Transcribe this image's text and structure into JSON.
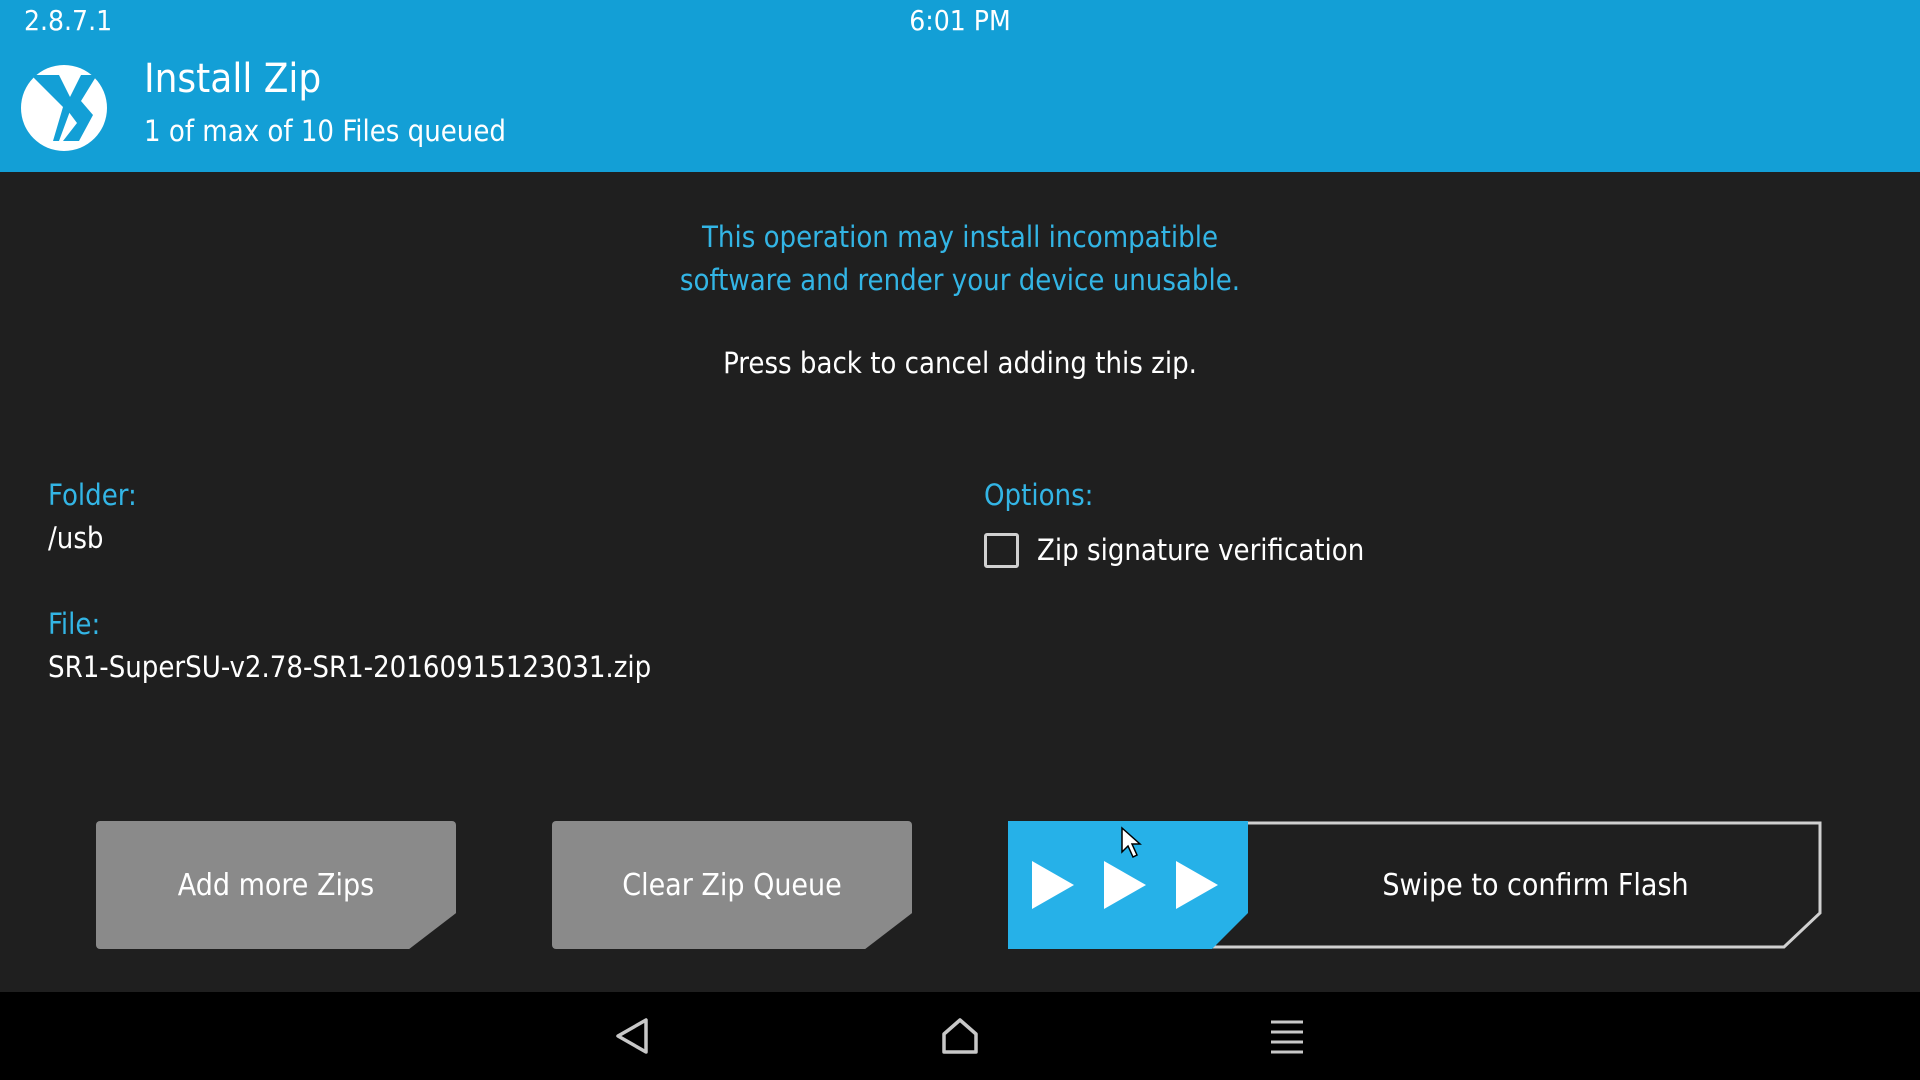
{
  "status": {
    "version": "2.8.7.1",
    "time": "6:01 PM"
  },
  "header": {
    "title": "Install Zip",
    "subtitle": "1 of max of 10 Files queued",
    "logo_icon": "twrp-logo-icon"
  },
  "warning": {
    "line1": "This operation may install incompatible",
    "line2": "software and render your device unusable."
  },
  "instruction": "Press back to cancel adding this zip.",
  "folder": {
    "label": "Folder:",
    "value": "/usb"
  },
  "file": {
    "label": "File:",
    "value": "SR1-SuperSU-v2.78-SR1-20160915123031.zip"
  },
  "options": {
    "label": "Options:",
    "zip_signature_verification": {
      "label": "Zip signature verification",
      "checked": false
    }
  },
  "buttons": {
    "add_more": "Add more Zips",
    "clear_queue": "Clear Zip Queue"
  },
  "slider": {
    "label": "Swipe to confirm Flash",
    "handle_icon": "triple-play-arrows-icon"
  },
  "nav": {
    "back_icon": "back-triangle-icon",
    "home_icon": "home-icon",
    "menu_icon": "menu-lines-icon"
  },
  "colors": {
    "header": "#139fd6",
    "accent_text": "#33b5e5",
    "background": "#1f1f1f",
    "button": "#8a8a8a",
    "slider_handle": "#26b1e8"
  }
}
